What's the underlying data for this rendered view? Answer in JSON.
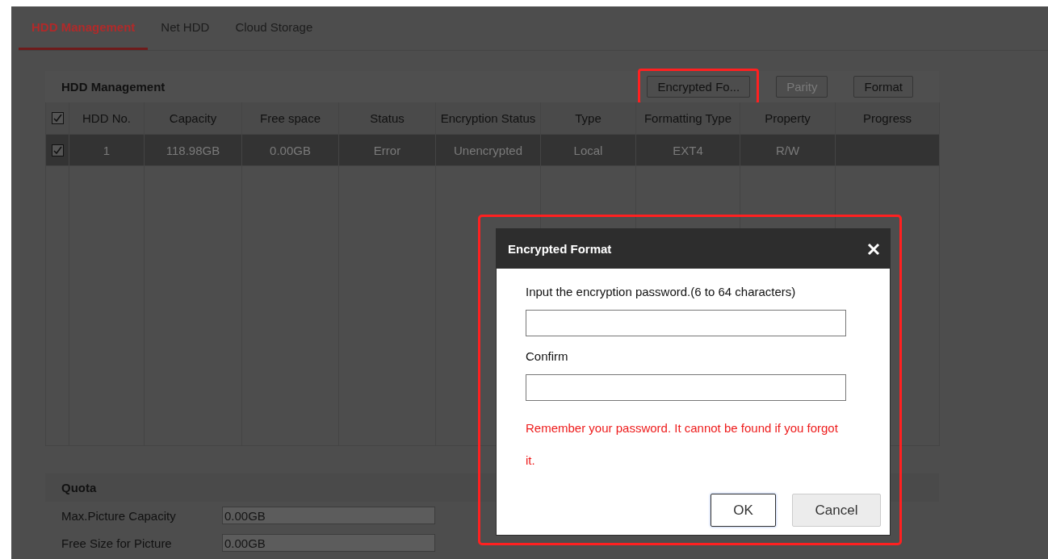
{
  "tabs": [
    {
      "label": "HDD Management",
      "selected": true
    },
    {
      "label": "Net HDD",
      "selected": false
    },
    {
      "label": "Cloud Storage",
      "selected": false
    }
  ],
  "hdd_panel": {
    "title": "HDD Management",
    "buttons": [
      {
        "label": "Encrypted Fo...",
        "disabled": false,
        "highlighted": true
      },
      {
        "label": "Parity",
        "disabled": true,
        "highlighted": false
      },
      {
        "label": "Format",
        "disabled": false,
        "highlighted": false
      }
    ],
    "table": {
      "all_checked": true,
      "columns": [
        "HDD No.",
        "Capacity",
        "Free space",
        "Status",
        "Encryption Status",
        "Type",
        "Formatting Type",
        "Property",
        "Progress"
      ],
      "rows": [
        {
          "checked": true,
          "selected": true,
          "cells": [
            "1",
            "118.98GB",
            "0.00GB",
            "Error",
            "Unencrypted",
            "Local",
            "EXT4",
            "R/W",
            ""
          ]
        }
      ]
    }
  },
  "quota": {
    "title": "Quota",
    "fields": [
      {
        "label": "Max.Picture Capacity",
        "value": "0.00GB"
      },
      {
        "label": "Free Size for Picture",
        "value": "0.00GB"
      }
    ]
  },
  "dialog": {
    "title": "Encrypted Format",
    "highlighted": true,
    "fields": [
      {
        "label": "Input the encryption password.(6 to 64 characters)"
      },
      {
        "label": "Confirm"
      }
    ],
    "warning": "Remember your password. It cannot be found if you forgot it.",
    "buttons": [
      {
        "label": "OK",
        "kind": "primary"
      },
      {
        "label": "Cancel",
        "kind": "secondary"
      }
    ]
  }
}
